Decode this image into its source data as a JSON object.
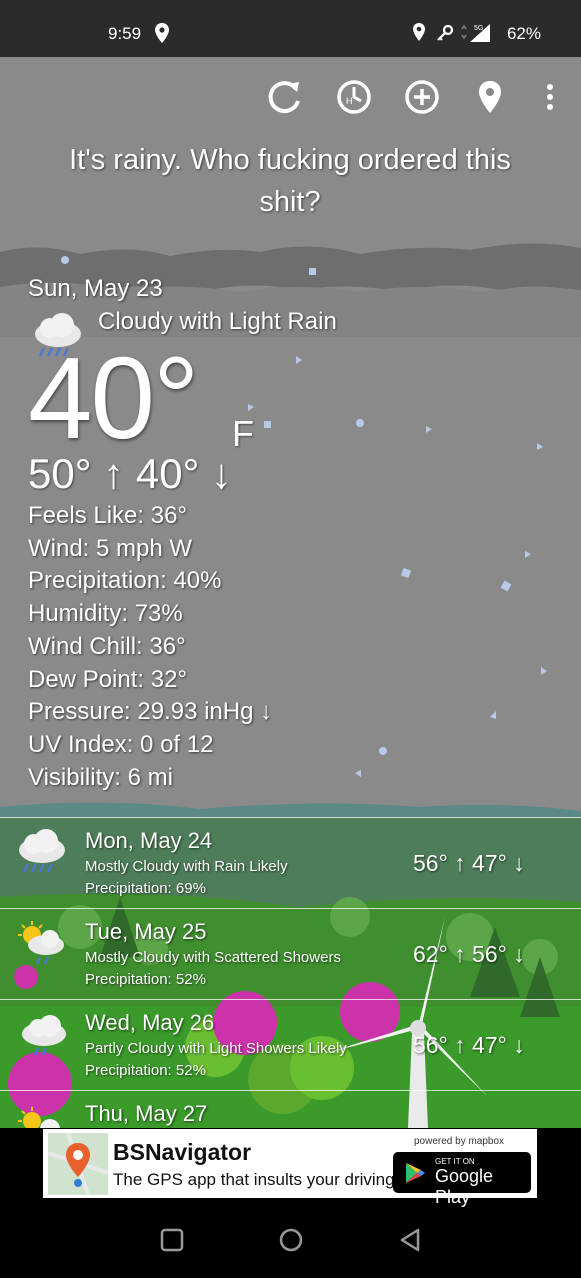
{
  "status_bar": {
    "time": "9:59",
    "network": "5G",
    "battery": "62%"
  },
  "toolbar": {
    "icons": [
      "refresh-icon",
      "history-icon",
      "add-icon",
      "location-icon",
      "more-icon"
    ]
  },
  "headline": "It's rainy. Who fucking ordered this shit?",
  "current": {
    "date": "Sun, May 23",
    "condition": "Cloudy with Light Rain",
    "temperature": "40°",
    "unit": "F",
    "hilo": "50° ↑  40° ↓",
    "details": [
      "Feels Like: 36°",
      "Wind: 5 mph W",
      "Precipitation: 40%",
      "Humidity: 73%",
      "Wind Chill: 36°",
      "Dew Point: 32°",
      "Pressure: 29.93 inHg ↓",
      "UV Index: 0 of 12",
      "Visibility: 6 mi"
    ]
  },
  "forecast": [
    {
      "day": "Mon, May 24",
      "condition": "Mostly Cloudy with Rain Likely",
      "precip": "Precipitation: 69%",
      "hilo": "56° ↑  47° ↓",
      "icon": "cloud-rain-icon"
    },
    {
      "day": "Tue, May 25",
      "condition": "Mostly Cloudy with Scattered Showers",
      "precip": "Precipitation: 52%",
      "hilo": "62° ↑  56° ↓",
      "icon": "sun-cloud-rain-icon"
    },
    {
      "day": "Wed, May 26",
      "condition": "Partly Cloudy with Light Showers Likely",
      "precip": "Precipitation: 52%",
      "hilo": "56° ↑  47° ↓",
      "icon": "cloud-rain-icon"
    },
    {
      "day": "Thu, May 27",
      "condition": "",
      "precip": "",
      "hilo": "",
      "icon": "sun-cloud-icon"
    }
  ],
  "ad": {
    "title": "BSNavigator",
    "tagline": "The GPS app that insults your driving.",
    "powered_by": "powered by mapbox",
    "store_small": "GET IT ON",
    "store_big": "Google Play"
  },
  "colors": {
    "background": "#8a8a8a",
    "status_bar": "#2b2b2b",
    "grass": "#3f8f2f",
    "text": "#ffffff"
  }
}
